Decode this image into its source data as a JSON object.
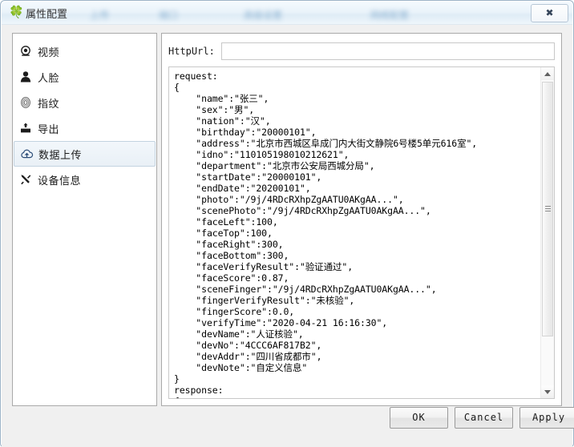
{
  "window": {
    "title": "属性配置",
    "icon": "clover-icon",
    "close_label": "✖",
    "obscured_labels": [
      "上传",
      "端口",
      "高级设置",
      "网络配置"
    ]
  },
  "sidebar": {
    "items": [
      {
        "label": "视频",
        "icon": "camera-icon",
        "selected": false
      },
      {
        "label": "人脸",
        "icon": "face-icon",
        "selected": false
      },
      {
        "label": "指纹",
        "icon": "fingerprint-icon",
        "selected": false
      },
      {
        "label": "导出",
        "icon": "export-icon",
        "selected": false
      },
      {
        "label": "数据上传",
        "icon": "cloud-upload-icon",
        "selected": true
      },
      {
        "label": "设备信息",
        "icon": "tools-icon",
        "selected": false
      }
    ]
  },
  "panel": {
    "url_label": "HttpUrl:",
    "url_value": "",
    "url_placeholder": "",
    "code_lines": [
      "request:",
      "{",
      "    \"name\":\"张三\",",
      "    \"sex\":\"男\",",
      "    \"nation\":\"汉\",",
      "    \"birthday\":\"20000101\",",
      "    \"address\":\"北京市西城区阜成门内大街文静院6号楼5单元616室\",",
      "    \"idno\":\"110105198010212621\",",
      "    \"department\":\"北京市公安局西城分局\",",
      "    \"startDate\":\"20000101\",",
      "    \"endDate\":\"20200101\",",
      "    \"photo\":\"/9j/4RDcRXhpZgAATU0AKgAA...\",",
      "    \"scenePhoto\":\"/9j/4RDcRXhpZgAATU0AKgAA...\",",
      "    \"faceLeft\":100,",
      "    \"faceTop\":100,",
      "    \"faceRight\":300,",
      "    \"faceBottom\":300,",
      "    \"faceVerifyResult\":\"验证通过\",",
      "    \"faceScore\":0.87,",
      "    \"sceneFinger\":\"/9j/4RDcRXhpZgAATU0AKgAA...\",",
      "    \"fingerVerifyResult\":\"未核验\",",
      "    \"fingerScore\":0.0,",
      "    \"verifyTime\":\"2020-04-21 16:16:30\",",
      "    \"devName\":\"人证核验\",",
      "    \"devNo\":\"4CCC6AF817B2\",",
      "    \"devAddr\":\"四川省成都市\",",
      "    \"devNote\":\"自定义信息\"",
      "}",
      "response:",
      "{"
    ]
  },
  "footer": {
    "ok_label": "OK",
    "cancel_label": "Cancel",
    "apply_label": "Apply"
  }
}
